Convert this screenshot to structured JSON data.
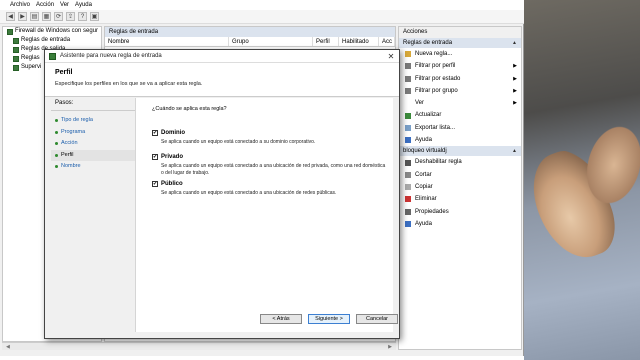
{
  "menu": [
    "Archivo",
    "Acción",
    "Ver",
    "Ayuda"
  ],
  "tree": [
    "Firewall de Windows con segur",
    "Reglas de entrada",
    "Reglas de salida",
    "Reglas",
    "Supervi"
  ],
  "center": {
    "title": "Reglas de entrada",
    "columns": [
      "Nombre",
      "Grupo",
      "Perfil",
      "Habilitado",
      "Acc"
    ]
  },
  "actions": {
    "title": "Acciones",
    "section1": "Reglas de entrada",
    "items1": [
      "Nueva regla...",
      "Filtrar por perfil",
      "Filtrar por estado",
      "Filtrar por grupo",
      "Ver",
      "Actualizar",
      "Exportar lista...",
      "Ayuda"
    ],
    "section2": "bloqueo virtualdj",
    "items2": [
      "Deshabilitar regla",
      "Cortar",
      "Copiar",
      "Eliminar",
      "Propiedades",
      "Ayuda"
    ]
  },
  "wizard": {
    "title": "Asistente para nueva regla de entrada",
    "header_title": "Perfil",
    "header_sub": "Especifique los perfiles en los que se va a aplicar esta regla.",
    "steps_title": "Pasos:",
    "steps": [
      "Tipo de regla",
      "Programa",
      "Acción",
      "Perfil",
      "Nombre"
    ],
    "question": "¿Cuándo se aplica esta regla?",
    "options": [
      {
        "label": "Dominio",
        "desc": "Se aplica cuando un equipo está conectado a su dominio corporativo.",
        "checked": true
      },
      {
        "label": "Privado",
        "desc": "Se aplica cuando un equipo está conectado a una ubicación de red privada, como una red doméstica o del lugar de trabajo.",
        "checked": true
      },
      {
        "label": "Público",
        "desc": "Se aplica cuando un equipo está conectado a una ubicación de redes públicas.",
        "checked": true
      }
    ],
    "buttons": {
      "back": "< Atrás",
      "next": "Siguiente >",
      "cancel": "Cancelar"
    }
  }
}
